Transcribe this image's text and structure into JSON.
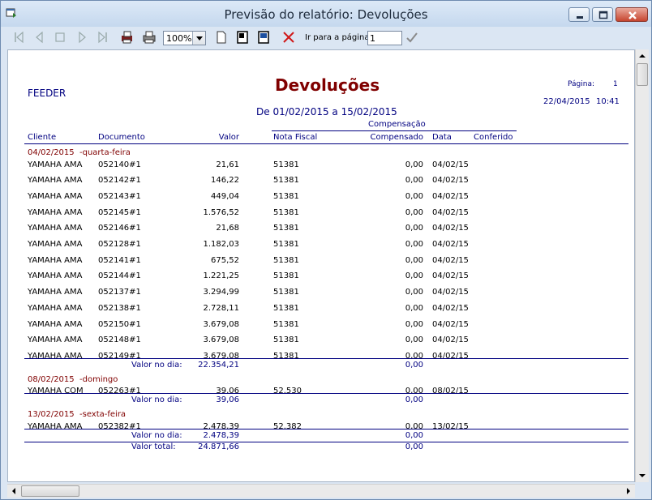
{
  "window": {
    "title": "Previsão do relatório: Devoluções"
  },
  "toolbar": {
    "zoom": "100%",
    "goto_label": "Ir para a página",
    "goto_value": "1"
  },
  "report": {
    "company": "FEEDER",
    "title": "Devoluções",
    "page_label": "Página:",
    "page_number": "1",
    "date": "22/04/2015",
    "time": "10:41",
    "period": "De 01/02/2015 a 15/02/2015",
    "group_header": "Compensação",
    "columns": [
      "Cliente",
      "Documento",
      "Valor",
      "Nota Fiscal",
      "Compensado",
      "Data",
      "Conferido"
    ],
    "groups": [
      {
        "date": "04/02/2015",
        "weekday": "-quarta-feira",
        "rows": [
          [
            "YAMAHA AMA",
            "052140#1",
            "21,61",
            "51381",
            "0,00",
            "04/02/15"
          ],
          [
            "YAMAHA AMA",
            "052142#1",
            "146,22",
            "51381",
            "0,00",
            "04/02/15"
          ],
          [
            "YAMAHA AMA",
            "052143#1",
            "449,04",
            "51381",
            "0,00",
            "04/02/15"
          ],
          [
            "YAMAHA AMA",
            "052145#1",
            "1.576,52",
            "51381",
            "0,00",
            "04/02/15"
          ],
          [
            "YAMAHA AMA",
            "052146#1",
            "21,68",
            "51381",
            "0,00",
            "04/02/15"
          ],
          [
            "YAMAHA AMA",
            "052128#1",
            "1.182,03",
            "51381",
            "0,00",
            "04/02/15"
          ],
          [
            "YAMAHA AMA",
            "052141#1",
            "675,52",
            "51381",
            "0,00",
            "04/02/15"
          ],
          [
            "YAMAHA AMA",
            "052144#1",
            "1.221,25",
            "51381",
            "0,00",
            "04/02/15"
          ],
          [
            "YAMAHA AMA",
            "052137#1",
            "3.294,99",
            "51381",
            "0,00",
            "04/02/15"
          ],
          [
            "YAMAHA AMA",
            "052138#1",
            "2.728,11",
            "51381",
            "0,00",
            "04/02/15"
          ],
          [
            "YAMAHA AMA",
            "052150#1",
            "3.679,08",
            "51381",
            "0,00",
            "04/02/15"
          ],
          [
            "YAMAHA AMA",
            "052148#1",
            "3.679,08",
            "51381",
            "0,00",
            "04/02/15"
          ],
          [
            "YAMAHA AMA",
            "052149#1",
            "3.679,08",
            "51381",
            "0,00",
            "04/02/15"
          ]
        ],
        "subtotal_label": "Valor no dia:",
        "subtotal_value": "22.354,21",
        "subtotal_comp": "0,00"
      },
      {
        "date": "08/02/2015",
        "weekday": "-domingo",
        "rows": [
          [
            "YAMAHA COM",
            "052263#1",
            "39,06",
            "52.530",
            "0,00",
            "08/02/15"
          ]
        ],
        "subtotal_label": "Valor no dia:",
        "subtotal_value": "39,06",
        "subtotal_comp": "0,00"
      },
      {
        "date": "13/02/2015",
        "weekday": "-sexta-feira",
        "rows": [
          [
            "YAMAHA AMA",
            "052382#1",
            "2.478,39",
            "52.382",
            "0,00",
            "13/02/15"
          ]
        ],
        "subtotal_label": "Valor no dia:",
        "subtotal_value": "2.478,39",
        "subtotal_comp": "0,00"
      }
    ],
    "total_label": "Valor total:",
    "total_value": "24.871,66",
    "total_comp": "0,00"
  }
}
